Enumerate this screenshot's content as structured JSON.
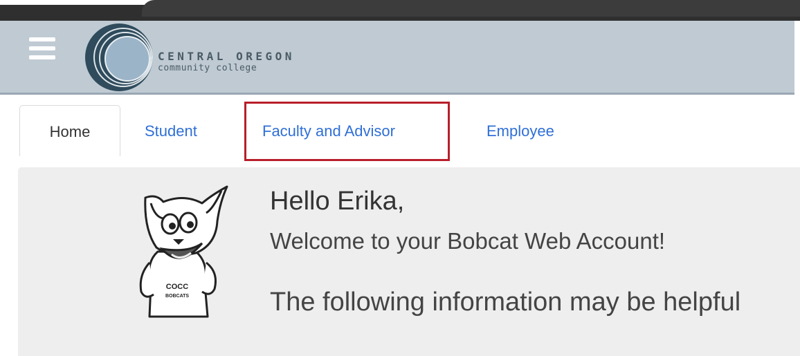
{
  "header": {
    "logo_line1": "CENTRAL OREGON",
    "logo_line2": "community college",
    "menu_icon": "hamburger-menu-icon",
    "logo_icon": "cocc-logo-icon"
  },
  "tabs": [
    {
      "label": "Home",
      "active": true
    },
    {
      "label": "Student"
    },
    {
      "label": "Faculty and Advisor",
      "highlighted": true
    },
    {
      "label": "Employee"
    }
  ],
  "content": {
    "greeting": "Hello Erika,",
    "welcome": "Welcome to your Bobcat Web Account!",
    "info": "The following information may be helpful",
    "mascot_shirt_line1": "COCC",
    "mascot_shirt_line2": "BOBCATS"
  },
  "colors": {
    "header_bg": "#bfcad3",
    "tab_link": "#2f6fd6",
    "highlight_border": "#b81e2a",
    "content_bg": "#eeeeee"
  }
}
